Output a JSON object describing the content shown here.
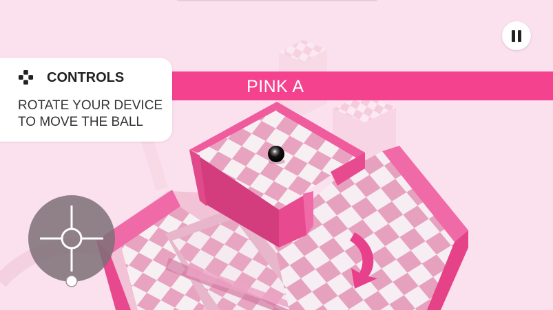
{
  "level": {
    "name": "PINK A"
  },
  "controls": {
    "title": "CONTROLS",
    "instruction": "ROTATE YOUR DEVICE TO MOVE THE BALL",
    "icon": "dpad-icon"
  },
  "hud": {
    "pause_icon": "pause-icon",
    "joystick_icon": "crosshair-icon"
  },
  "colors": {
    "background": "#fbe1ee",
    "accent_pink": "#f4428e",
    "tile_light": "#f7f0f3",
    "tile_pink": "#e8a3c0",
    "ball": "#111111"
  }
}
